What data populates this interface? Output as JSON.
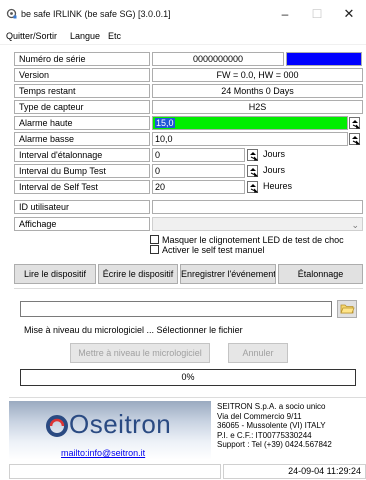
{
  "window": {
    "title": "be safe IRLINK (be safe SG) [3.0.0.1]",
    "icon": "app-gear-icon",
    "controls": {
      "minimize": "–",
      "maximize": "☐",
      "close": "✕"
    }
  },
  "menu": [
    "Quitter/Sortir",
    "Langue",
    "Etc"
  ],
  "fields": {
    "serial": {
      "label": "Numéro de série",
      "value": "0000000000"
    },
    "version": {
      "label": "Version",
      "value": "FW = 0.0,    HW = 000"
    },
    "remaining": {
      "label": "Temps restant",
      "value": "24 Months 0 Days"
    },
    "sensor": {
      "label": "Type de capteur",
      "value": "H2S"
    },
    "alarm_high": {
      "label": "Alarme haute",
      "value": "15,0"
    },
    "alarm_low": {
      "label": "Alarme basse",
      "value": "10,0"
    },
    "cal_interval": {
      "label": "Interval d'étalonnage",
      "value": "0",
      "unit": "Jours"
    },
    "bump_interval": {
      "label": "Interval du Bump Test",
      "value": "0",
      "unit": "Jours"
    },
    "self_interval": {
      "label": "Interval de Self Test",
      "value": "20",
      "unit": "Heures"
    },
    "user_id": {
      "label": "ID utilisateur",
      "value": ""
    },
    "display": {
      "label": "Affichage",
      "value": ""
    }
  },
  "checkboxes": {
    "mask_led": {
      "label": "Masquer le clignotement LED de test de choc",
      "checked": false
    },
    "manual_self": {
      "label": "Activer le self test manuel",
      "checked": false
    }
  },
  "buttons": {
    "read": "Lire le dispositif",
    "write": "Écrire le dispositif",
    "save_event": "Enregistrer l'événement",
    "calibration": "Étalonnage",
    "update_fw": "Mettre à niveau le micrologiciel",
    "cancel": "Annuler"
  },
  "firmware": {
    "file_path": "",
    "status": "Mise à niveau du micrologiciel ... Sélectionner le fichier",
    "progress_label": "0%",
    "progress_fraction": 0
  },
  "footer": {
    "logo": "Oseitron",
    "email": "mailto:info@seitron.it",
    "company_lines": [
      "SEITRON S.p.A. a socio unico",
      "Via del Commercio 9/11",
      "36065 - Mussolente (VI) ITALY",
      "P.I. e C.F.: IT00775330244",
      "Support : Tel (+39) 0424.567842"
    ]
  },
  "status": {
    "left": "",
    "datetime": "24-09-04 11:29:24"
  },
  "colors": {
    "serial_box": "#0000ff",
    "alarm_high_bg": "#00ee00",
    "selection": "#1e57d7",
    "logo": "#2a4a82",
    "link": "#0000ee"
  }
}
